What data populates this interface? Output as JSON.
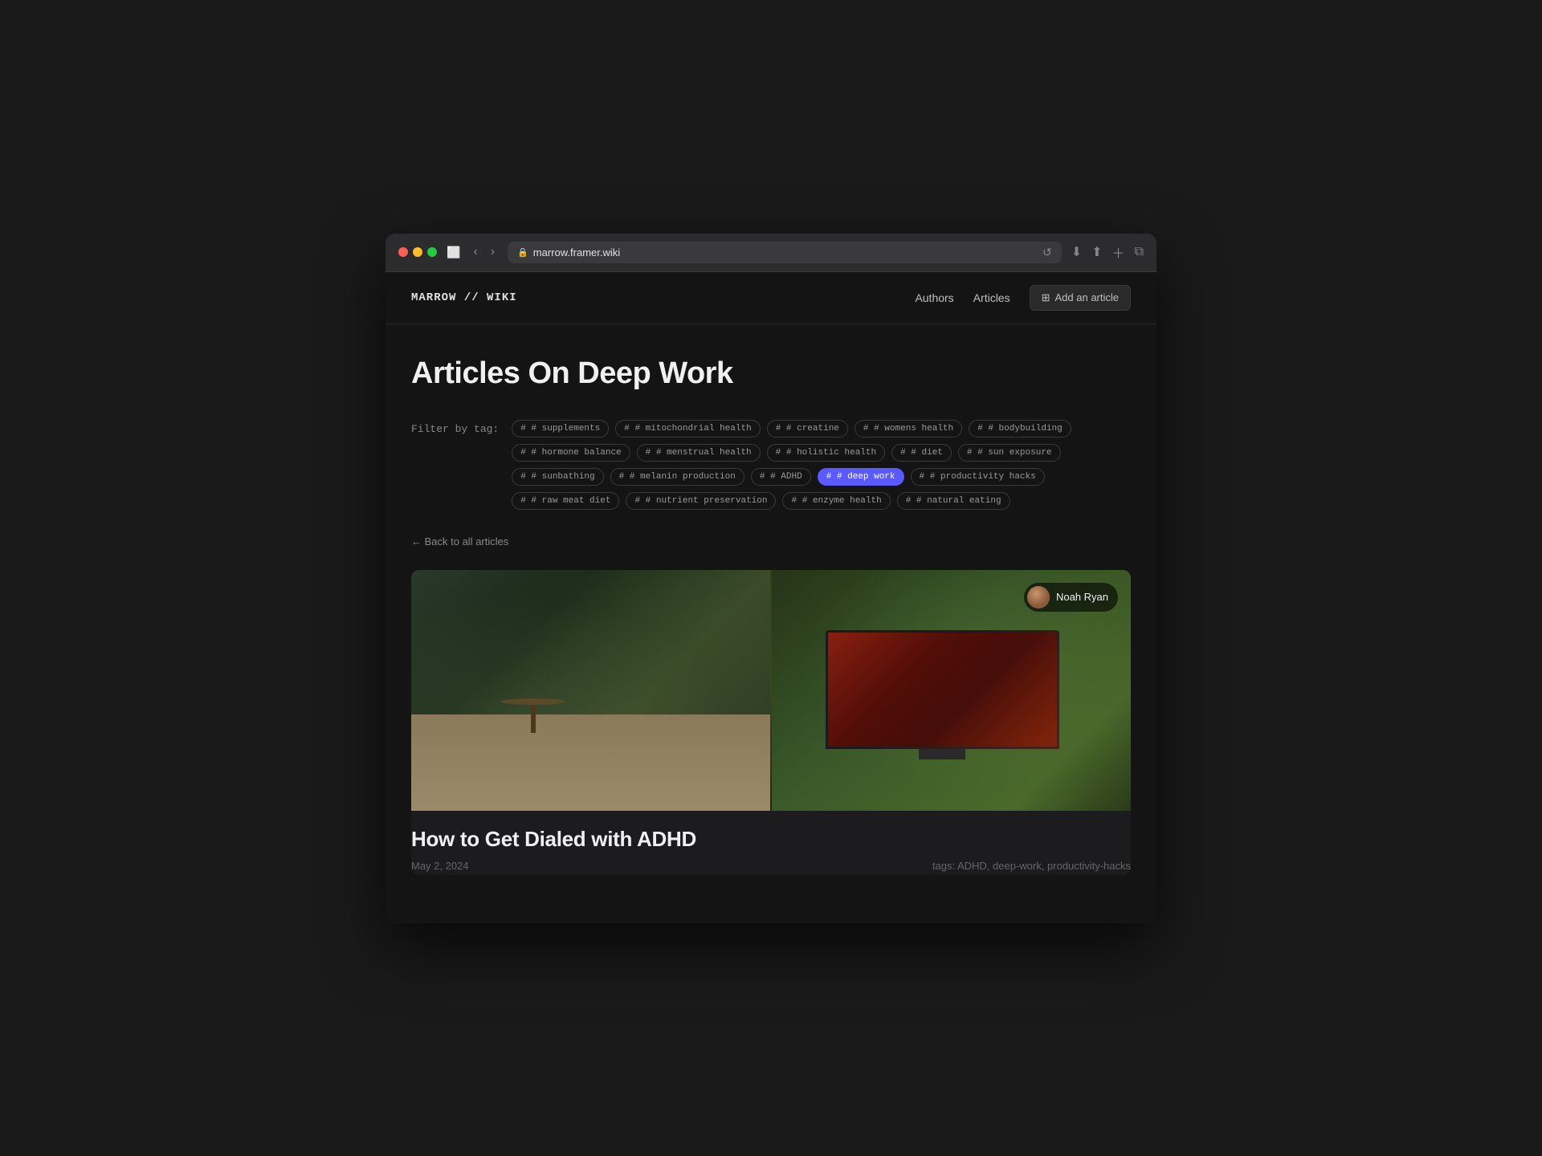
{
  "browser": {
    "url": "marrow.framer.wiki",
    "reload_icon": "↺"
  },
  "nav": {
    "logo": "MARROW // WIKI",
    "links": [
      {
        "label": "Authors",
        "href": "#"
      },
      {
        "label": "Articles",
        "href": "#"
      }
    ],
    "add_btn": {
      "icon": "⊞",
      "label": "Add an article"
    }
  },
  "page": {
    "title": "Articles On Deep Work",
    "filter_label": "Filter by tag:",
    "back_link": "← Back to all articles",
    "tags": [
      {
        "label": "supplements",
        "active": false
      },
      {
        "label": "mitochondrial health",
        "active": false
      },
      {
        "label": "creatine",
        "active": false
      },
      {
        "label": "womens health",
        "active": false
      },
      {
        "label": "bodybuilding",
        "active": false
      },
      {
        "label": "hormone balance",
        "active": false
      },
      {
        "label": "menstrual health",
        "active": false
      },
      {
        "label": "holistic health",
        "active": false
      },
      {
        "label": "diet",
        "active": false
      },
      {
        "label": "sun exposure",
        "active": false
      },
      {
        "label": "sunbathing",
        "active": false
      },
      {
        "label": "melanin production",
        "active": false
      },
      {
        "label": "ADHD",
        "active": false
      },
      {
        "label": "deep work",
        "active": true
      },
      {
        "label": "productivity hacks",
        "active": false
      },
      {
        "label": "raw meat diet",
        "active": false
      },
      {
        "label": "nutrient preservation",
        "active": false
      },
      {
        "label": "enzyme health",
        "active": false
      },
      {
        "label": "natural eating",
        "active": false
      }
    ]
  },
  "article": {
    "title": "How to Get Dialed with ADHD",
    "date": "May 2, 2024",
    "tags_label": "tags: ADHD, deep-work, productivity-hacks",
    "author": {
      "name": "Noah Ryan"
    }
  }
}
